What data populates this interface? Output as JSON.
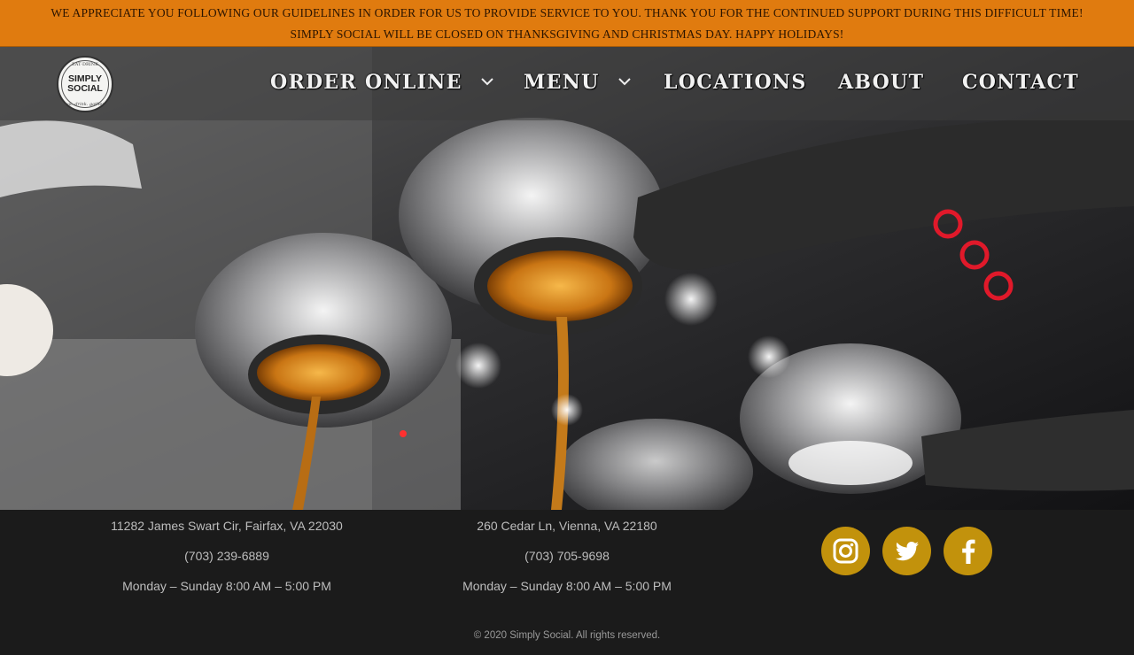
{
  "announcement": {
    "line1": "WE APPRECIATE YOU FOLLOWING OUR GUIDELINES IN ORDER FOR US TO PROVIDE SERVICE TO YOU. THANK YOU FOR THE CONTINUED SUPPORT DURING THIS DIFFICULT TIME!",
    "line2": "SIMPLY SOCIAL WILL BE CLOSED ON THANKSGIVING AND CHRISTMAS DAY. HAPPY HOLIDAYS!"
  },
  "logo": {
    "top": "EAT·DRINK",
    "name_line1": "SIMPLY",
    "name_line2": "SOCIAL",
    "tagline": "eat. drink. gather."
  },
  "nav": {
    "order_online": "ORDER ONLINE",
    "menu": "MENU",
    "locations": "LOCATIONS",
    "about": "ABOUT",
    "contact": "CONTACT"
  },
  "locations": [
    {
      "address": "11282 James Swart Cir, Fairfax, VA 22030",
      "phone": "(703) 239-6889",
      "hours": "Monday – Sunday  8:00 AM – 5:00 PM"
    },
    {
      "address": "260 Cedar Ln, Vienna, VA 22180",
      "phone": "(703) 705-9698",
      "hours": "Monday – Sunday  8:00 AM – 5:00 PM"
    }
  ],
  "social": [
    "instagram-icon",
    "twitter-icon",
    "facebook-icon"
  ],
  "colors": {
    "announcement_bg": "#e07b0f",
    "social_bg": "#c2920c",
    "footer_bg": "#1b1b1b"
  },
  "copyright": "© 2020 Simply Social. All rights reserved."
}
